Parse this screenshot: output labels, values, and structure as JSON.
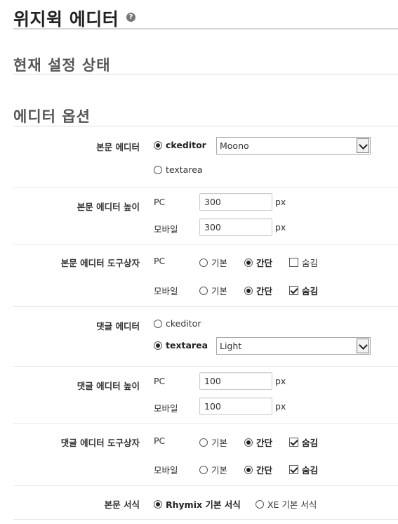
{
  "header": {
    "title": "위지윅 에디터",
    "help_icon": "question-circle-icon",
    "help_glyph": "?"
  },
  "sections": {
    "current_status": "현재 설정 상태",
    "editor_options": "에디터 옵션"
  },
  "labels": {
    "body_editor": "본문 에디터",
    "body_editor_height": "본문 에디터 높이",
    "body_editor_toolbar": "본문 에디터 도구상자",
    "comment_editor": "댓글 에디터",
    "comment_editor_height": "댓글 에디터 높이",
    "comment_editor_toolbar": "댓글 에디터 도구상자",
    "body_format": "본문 서식"
  },
  "common": {
    "pc": "PC",
    "mobile": "모바일",
    "px": "px",
    "basic": "기본",
    "simple": "간단",
    "hide": "숨김"
  },
  "body_editor": {
    "option_ckeditor": "ckeditor",
    "option_textarea": "textarea",
    "selected": "ckeditor",
    "skin_value": "Moono"
  },
  "body_height": {
    "pc": "300",
    "mobile": "300"
  },
  "body_toolbar": {
    "pc_selected": "간단",
    "pc_hide": false,
    "mobile_selected": "간단",
    "mobile_hide": true
  },
  "comment_editor": {
    "option_ckeditor": "ckeditor",
    "option_textarea": "textarea",
    "selected": "textarea",
    "skin_value": "Light"
  },
  "comment_height": {
    "pc": "100",
    "mobile": "100"
  },
  "comment_toolbar": {
    "pc_selected": "간단",
    "pc_hide": true,
    "mobile_selected": "간단",
    "mobile_hide": true
  },
  "body_format": {
    "option_rhymix": "Rhymix 기본 서식",
    "option_xe": "XE 기본 서식",
    "selected": "Rhymix 기본 서식"
  }
}
